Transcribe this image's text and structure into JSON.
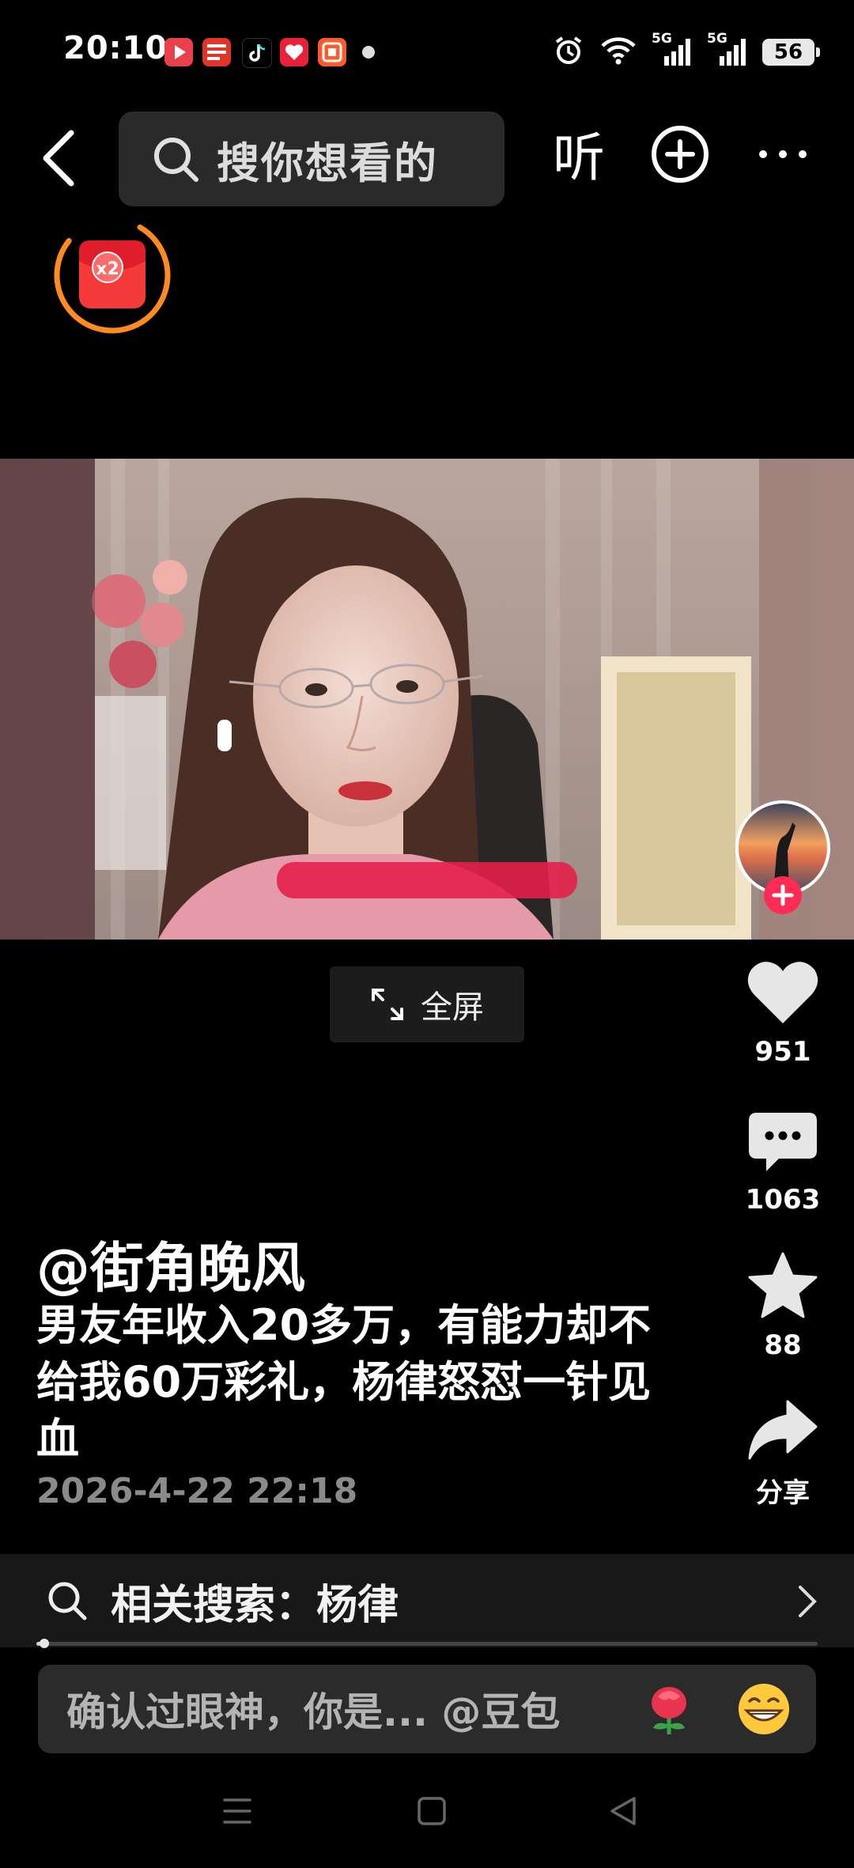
{
  "status_bar": {
    "time": "20:10",
    "network_1": "5G",
    "network_2": "5G",
    "battery": "56",
    "app_icons": [
      "video-app-icon",
      "toutiao-icon",
      "tiktok-icon",
      "douyu-icon",
      "taobao-icon"
    ]
  },
  "top_nav": {
    "search_placeholder": "搜你想看的",
    "listen_label": "听"
  },
  "red_packet": {
    "multiplier": "x2"
  },
  "right_rail": {
    "likes": "951",
    "comments": "1063",
    "favorites": "88",
    "share_label": "分享"
  },
  "fullscreen": {
    "label": "全屏"
  },
  "caption": {
    "author": "@街角晚风",
    "description": "男友年收入20多万，有能力却不给我60万彩礼，杨律怒怼一针见血",
    "timestamp": "2026-4-22 22:18"
  },
  "related_search": {
    "label": "相关搜索：杨律"
  },
  "playback": {
    "progress_fraction": 0.01
  },
  "comment_input": {
    "placeholder": "确认过眼神，你是... @豆包"
  },
  "colors": {
    "accent_red": "#fe2c55",
    "orange_ring": "#ff8a1e",
    "background": "#000000"
  }
}
